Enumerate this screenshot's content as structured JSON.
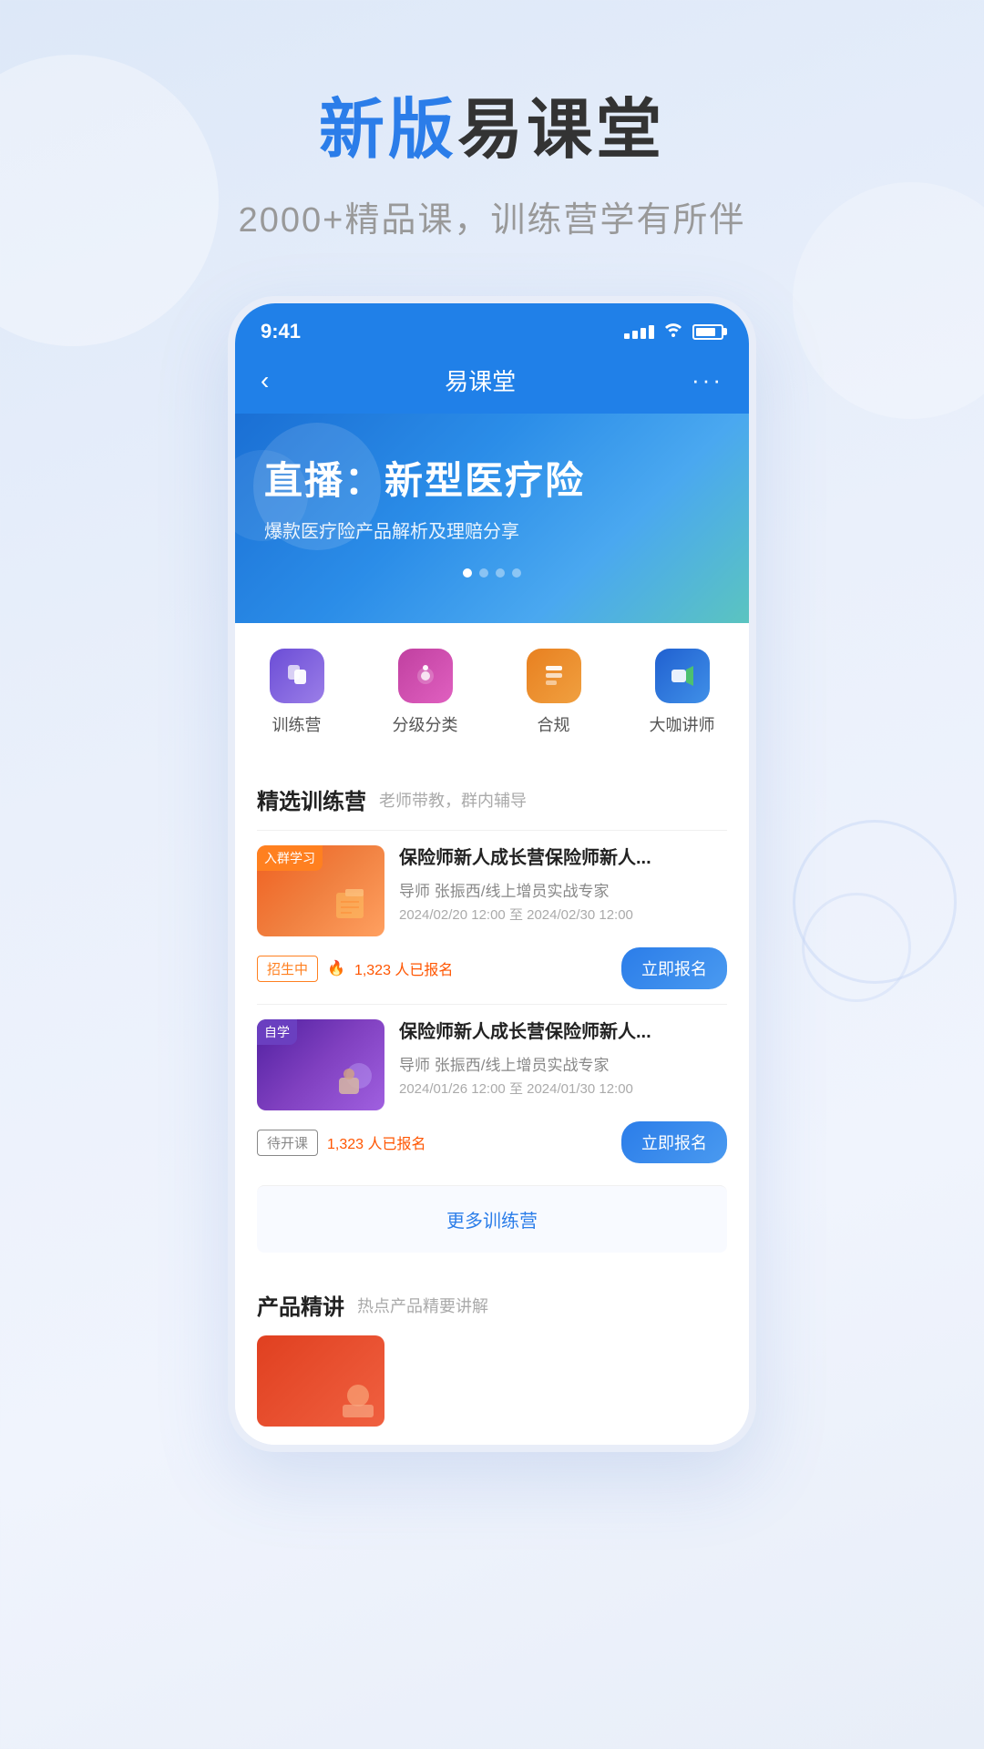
{
  "header": {
    "title_blue": "新版",
    "title_rest": "易课堂",
    "subtitle": "2000+精品课，训练营学有所伴"
  },
  "phone": {
    "status_bar": {
      "time": "9:41",
      "signal_label": "signal",
      "wifi_label": "wifi",
      "battery_label": "battery"
    },
    "nav": {
      "back_icon": "‹",
      "title": "易课堂",
      "more_icon": "···"
    },
    "banner": {
      "title": "直播：新型医疗险",
      "subtitle": "爆款医疗险产品解析及理赔分享",
      "dots": [
        true,
        false,
        false,
        false
      ]
    },
    "quick_menu": {
      "items": [
        {
          "icon": "training",
          "label": "训练营"
        },
        {
          "icon": "category",
          "label": "分级分类"
        },
        {
          "icon": "compliance",
          "label": "合规"
        },
        {
          "icon": "speaker",
          "label": "大咖讲师"
        }
      ]
    },
    "featured_section": {
      "title": "精选训练营",
      "desc": "老师带教，群内辅导",
      "courses": [
        {
          "badge": "入群学习",
          "badge_type": "group",
          "name": "保险师新人成长营保险师新人...",
          "teacher": "导师 张振西/线上增员实战专家",
          "time": "2024/02/20 12:00 至 2024/02/30 12:00",
          "status": "招生中",
          "status_type": "recruiting",
          "count": "1,323 人已报名",
          "btn": "立即报名"
        },
        {
          "badge": "自学",
          "badge_type": "self",
          "name": "保险师新人成长营保险师新人...",
          "teacher": "导师 张振西/线上增员实战专家",
          "time": "2024/01/26 12:00 至 2024/01/30 12:00",
          "status": "待开课",
          "status_type": "pending",
          "count": "1,323 人已报名",
          "btn": "立即报名"
        }
      ],
      "more_btn": "更多训练营"
    },
    "product_section": {
      "title": "产品精讲",
      "desc": "热点产品精要讲解"
    }
  }
}
